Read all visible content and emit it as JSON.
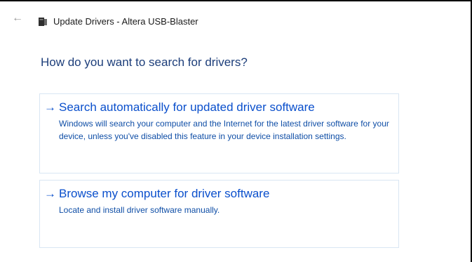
{
  "window": {
    "title": "Update Drivers - Altera USB-Blaster",
    "back_icon": "back-arrow-icon",
    "app_icon": "device-icon"
  },
  "page": {
    "heading": "How do you want to search for drivers?"
  },
  "options": [
    {
      "arrow": "→",
      "title": "Search automatically for updated driver software",
      "description": "Windows will search your computer and the Internet for the latest driver software for your device, unless you've disabled this feature in your device installation settings."
    },
    {
      "arrow": "→",
      "title": "Browse my computer for driver software",
      "description": "Locate and install driver software manually."
    }
  ],
  "colors": {
    "heading": "#1d3e7a",
    "link": "#0a4fcc",
    "description": "#0f4ea6",
    "option_border": "#d9e6f3"
  }
}
